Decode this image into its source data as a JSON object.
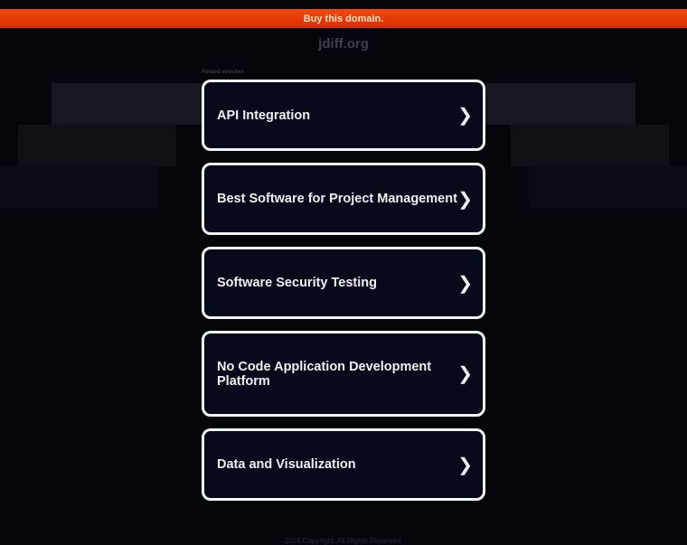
{
  "banner": {
    "label": "Buy this domain."
  },
  "site": {
    "domain": "jdiff.org"
  },
  "related": {
    "heading": "Related searches",
    "items": [
      {
        "label": "API Integration"
      },
      {
        "label": "Best Software for Project Management"
      },
      {
        "label": "Software Security Testing"
      },
      {
        "label": "No Code Application Development Platform"
      },
      {
        "label": "Data and Visualization"
      }
    ]
  },
  "footer": {
    "text": "2024 Copyright. All Rights Reserved."
  },
  "colors": {
    "banner": "#e63a05",
    "card_bg": "#070a1a",
    "card_border": "#f4f4f6"
  }
}
